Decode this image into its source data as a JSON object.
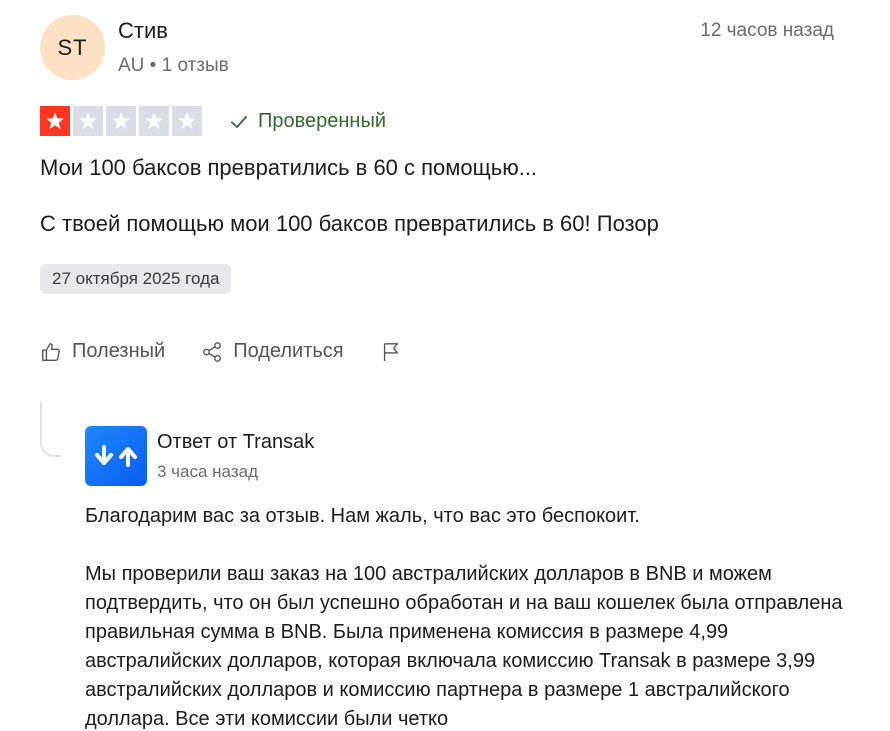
{
  "review": {
    "avatar_initials": "ST",
    "author": "Стив",
    "meta": "AU • 1 отзыв",
    "time_ago": "12 часов назад",
    "rating": 1,
    "rating_max": 5,
    "verified_label": "Проверенный",
    "title": "Мои 100 баксов превратились в 60 с помощью...",
    "text": "С твоей помощью мои 100 баксов превратились в 60! Позор",
    "date": "27 октября 2025 года"
  },
  "actions": {
    "useful_label": "Полезный",
    "share_label": "Поделиться"
  },
  "reply": {
    "from": "Ответ от Transak",
    "time_ago": "3 часа назад",
    "paragraph_1": "Благодарим вас за отзыв. Нам жаль, что вас это беспокоит.",
    "paragraph_2": "Мы проверили ваш заказ на 100 австралийских долларов в BNB и можем подтвердить, что он был успешно обработан и на ваш кошелек была отправлена правильная сумма в BNB. Была применена комиссия в размере 4,99 австралийских долларов, которая включала комиссию Transak в размере 3,99 австралийских долларов и комиссию партнера в размере 1 австралийского доллара. Все эти комиссии были четко"
  },
  "colors": {
    "star_active": "#ff3722",
    "star_inactive": "#dcdce6",
    "verified": "#2e6b2e",
    "avatar_bg": "#fbe0c4",
    "brand": "#1e88ff"
  },
  "icons": {
    "star": "star-icon",
    "verified": "checkmark-icon",
    "useful": "thumbs-up-icon",
    "share": "share-icon",
    "report": "flag-icon",
    "logo": "transak-logo"
  }
}
